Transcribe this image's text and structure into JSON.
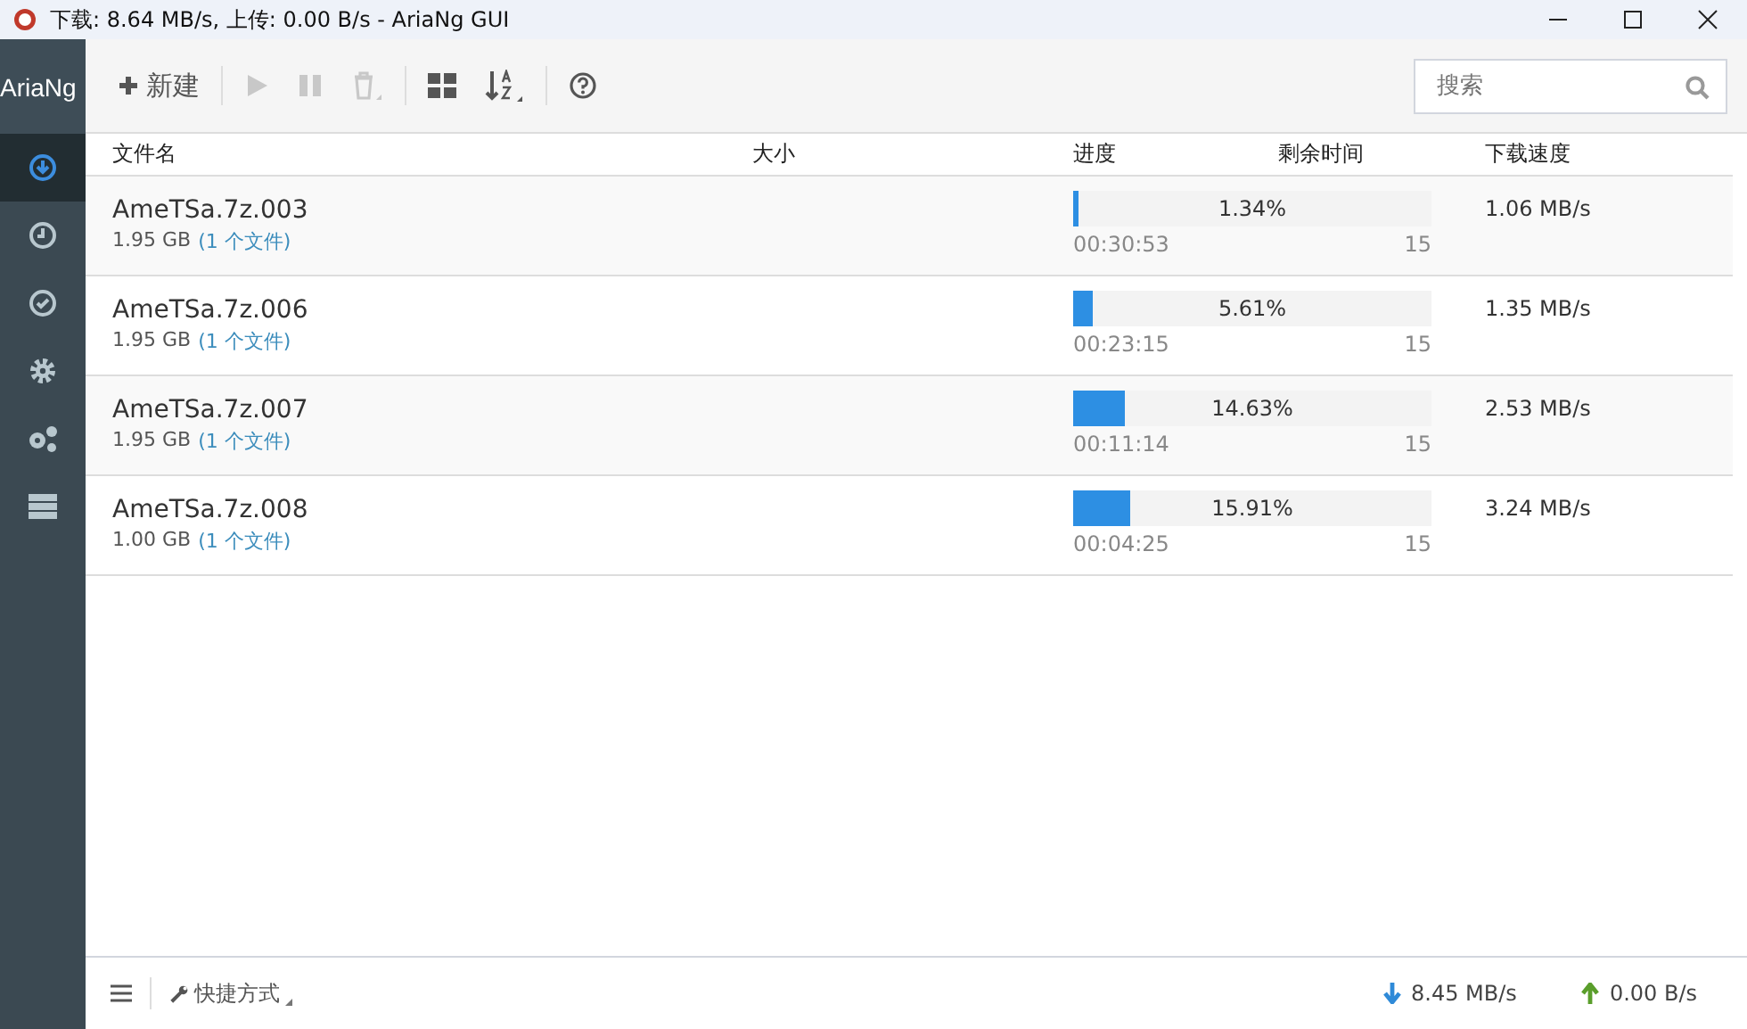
{
  "window": {
    "title": "下载: 8.64 MB/s, 上传: 0.00 B/s - AriaNg GUI"
  },
  "sidebar": {
    "brand": "AriaNg",
    "items": [
      {
        "kind": "downloading",
        "selected": true
      },
      {
        "kind": "waiting",
        "selected": false
      },
      {
        "kind": "stopped",
        "selected": false
      },
      {
        "kind": "settings",
        "selected": false
      },
      {
        "kind": "ariang-settings",
        "selected": false
      },
      {
        "kind": "status",
        "selected": false
      }
    ]
  },
  "toolbar": {
    "items": [
      {
        "kind": "new",
        "label": "新建",
        "disabled": false
      },
      {
        "kind": "start",
        "disabled": true
      },
      {
        "kind": "pause",
        "disabled": true
      },
      {
        "kind": "delete",
        "disabled": true
      },
      {
        "kind": "display",
        "disabled": false
      },
      {
        "kind": "sort",
        "disabled": false
      },
      {
        "kind": "help",
        "disabled": false
      }
    ],
    "search": {
      "placeholder": "搜索"
    }
  },
  "table": {
    "columns": [
      "文件名",
      "大小",
      "进度",
      "剩余时间",
      "下载速度"
    ],
    "rows": [
      {
        "name": "AmeTSa.7z.003",
        "size": "1.95 GB",
        "files": "(1 个文件)",
        "level": 0.0134,
        "percent": "1.34%",
        "remaining": "00:30:53",
        "connections": "15",
        "speed": "1.06 MB/s"
      },
      {
        "name": "AmeTSa.7z.006",
        "size": "1.95 GB",
        "files": "(1 个文件)",
        "level": 0.0561,
        "percent": "5.61%",
        "remaining": "00:23:15",
        "connections": "15",
        "speed": "1.35 MB/s"
      },
      {
        "name": "AmeTSa.7z.007",
        "size": "1.95 GB",
        "files": "(1 个文件)",
        "level": 0.1463,
        "percent": "14.63%",
        "remaining": "00:11:14",
        "connections": "15",
        "speed": "2.53 MB/s"
      },
      {
        "name": "AmeTSa.7z.008",
        "size": "1.00 GB",
        "files": "(1 个文件)",
        "level": 0.1591,
        "percent": "15.91%",
        "remaining": "00:04:25",
        "connections": "15",
        "speed": "3.24 MB/s"
      }
    ]
  },
  "footer": {
    "shortcuts": "快捷方式",
    "download_speed": "8.45 MB/s",
    "upload_speed": "0.00 B/s"
  }
}
